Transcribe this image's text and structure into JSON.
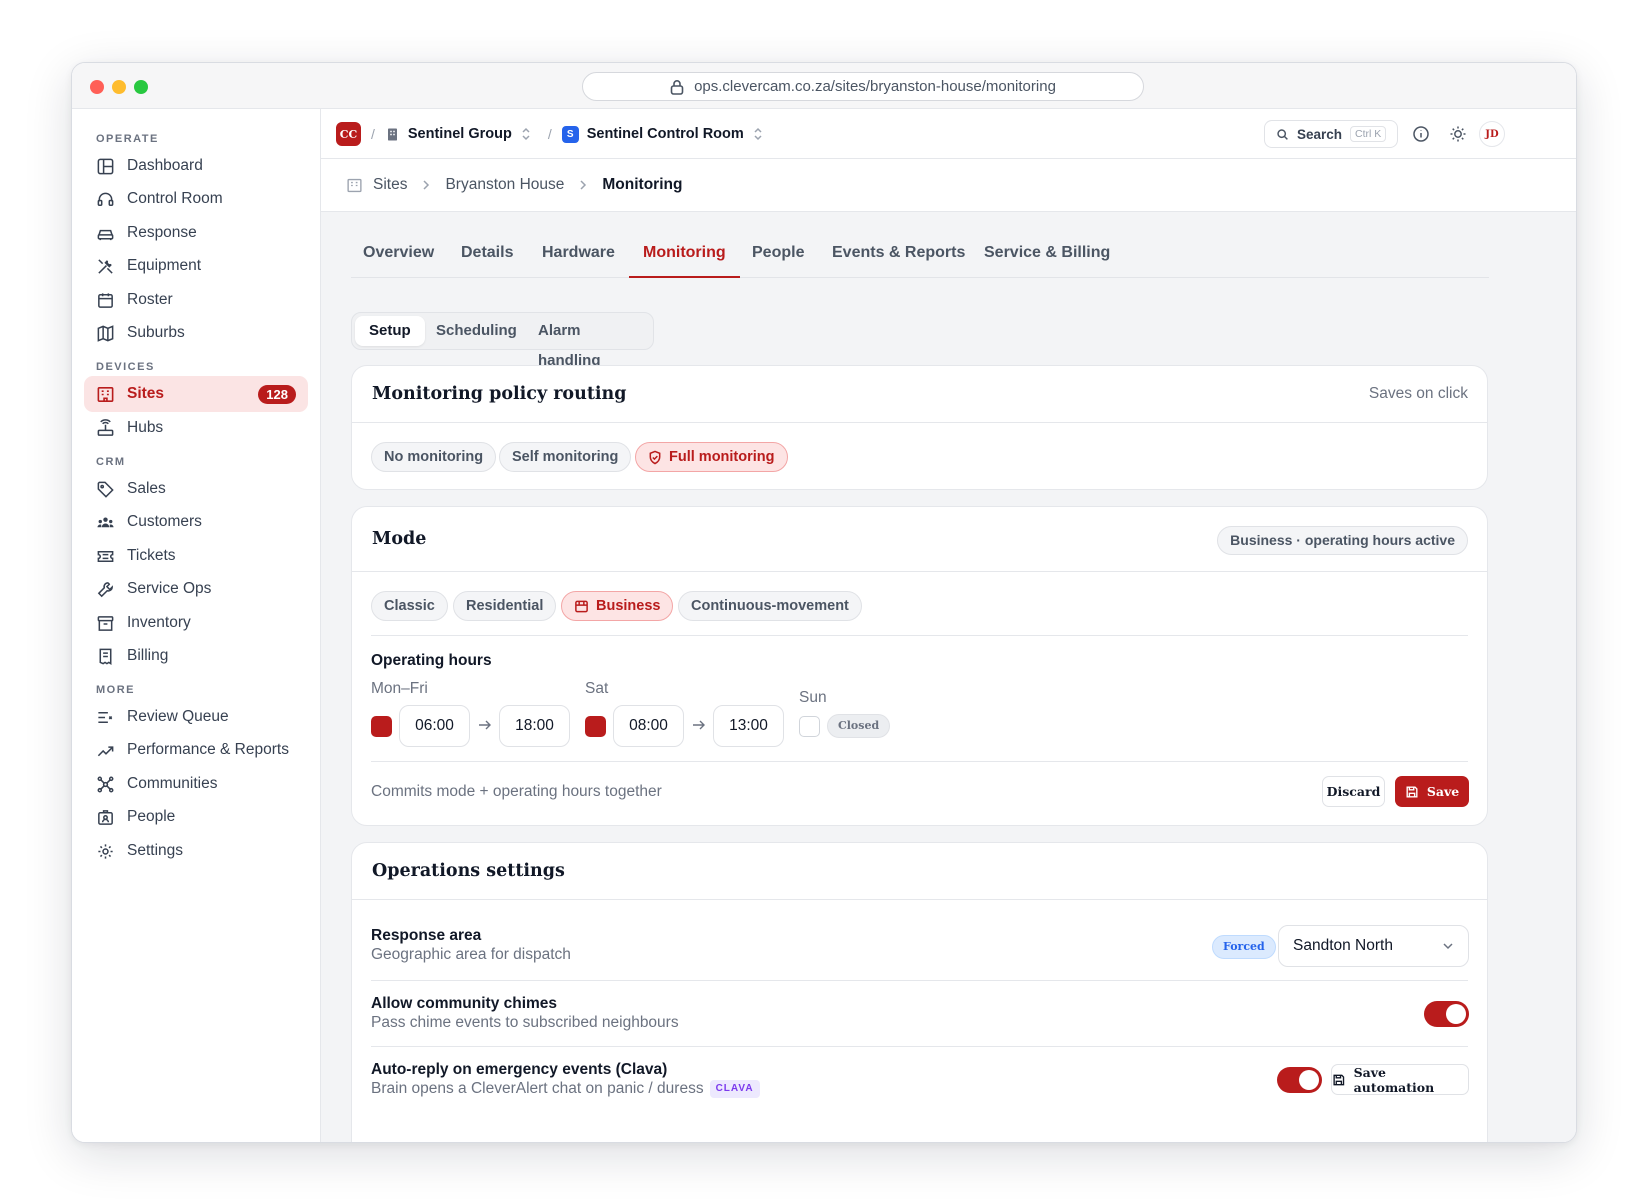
{
  "browser": {
    "url": "ops.clevercam.co.za/sites/bryanston-house/monitoring"
  },
  "sidebar": {
    "sections": [
      "OPERATE",
      "DEVICES",
      "CRM",
      "MORE"
    ],
    "items": [
      {
        "label": "Dashboard"
      },
      {
        "label": "Control Room"
      },
      {
        "label": "Response"
      },
      {
        "label": "Equipment"
      },
      {
        "label": "Roster"
      },
      {
        "label": "Suburbs"
      },
      {
        "label": "Sites",
        "badge": "128"
      },
      {
        "label": "Hubs"
      },
      {
        "label": "Sales"
      },
      {
        "label": "Customers"
      },
      {
        "label": "Tickets"
      },
      {
        "label": "Service Ops"
      },
      {
        "label": "Inventory"
      },
      {
        "label": "Billing"
      },
      {
        "label": "Review Queue"
      },
      {
        "label": "Performance & Reports"
      },
      {
        "label": "Communities"
      },
      {
        "label": "People"
      },
      {
        "label": "Settings"
      }
    ]
  },
  "topbar": {
    "logo": "CC",
    "org": "Sentinel Group",
    "workspace_badge": "S",
    "workspace": "Sentinel Control Room",
    "search_label": "Search",
    "search_shortcut": "Ctrl K",
    "avatar": "JD"
  },
  "breadcrumb": [
    "Sites",
    "Bryanston House",
    "Monitoring"
  ],
  "tabs": [
    "Overview",
    "Details",
    "Hardware",
    "Monitoring",
    "People",
    "Events & Reports",
    "Service & Billing"
  ],
  "subtabs": [
    "Setup",
    "Scheduling",
    "Alarm handling"
  ],
  "policy": {
    "title": "Monitoring policy routing",
    "hint": "Saves on click",
    "options": [
      "No monitoring",
      "Self monitoring",
      "Full monitoring"
    ]
  },
  "mode": {
    "title": "Mode",
    "status": "Business · operating hours active",
    "options": [
      "Classic",
      "Residential",
      "Business",
      "Continuous-movement"
    ],
    "hours_title": "Operating hours",
    "days": [
      {
        "label": "Mon–Fri",
        "from": "06:00",
        "to": "18:00"
      },
      {
        "label": "Sat",
        "from": "08:00",
        "to": "13:00"
      },
      {
        "label": "Sun",
        "closed": "Closed"
      }
    ],
    "footer_note": "Commits mode + operating hours together",
    "discard": "Discard",
    "save": "Save"
  },
  "operations": {
    "title": "Operations settings",
    "response_area": {
      "label": "Response area",
      "sub": "Geographic area for dispatch",
      "tag": "Forced",
      "value": "Sandton North"
    },
    "chimes": {
      "label": "Allow community chimes",
      "sub": "Pass chime events to subscribed neighbours"
    },
    "auto_reply": {
      "label": "Auto-reply on emergency events (Clava)",
      "sub": "Brain opens a CleverAlert chat on panic / duress",
      "tag": "CLAVA",
      "button": "Save automation"
    }
  },
  "colors": {
    "accent": "#b91c1c",
    "accent_soft": "#fde4e4",
    "blue": "#2563eb",
    "clava": "#7c3aed"
  }
}
